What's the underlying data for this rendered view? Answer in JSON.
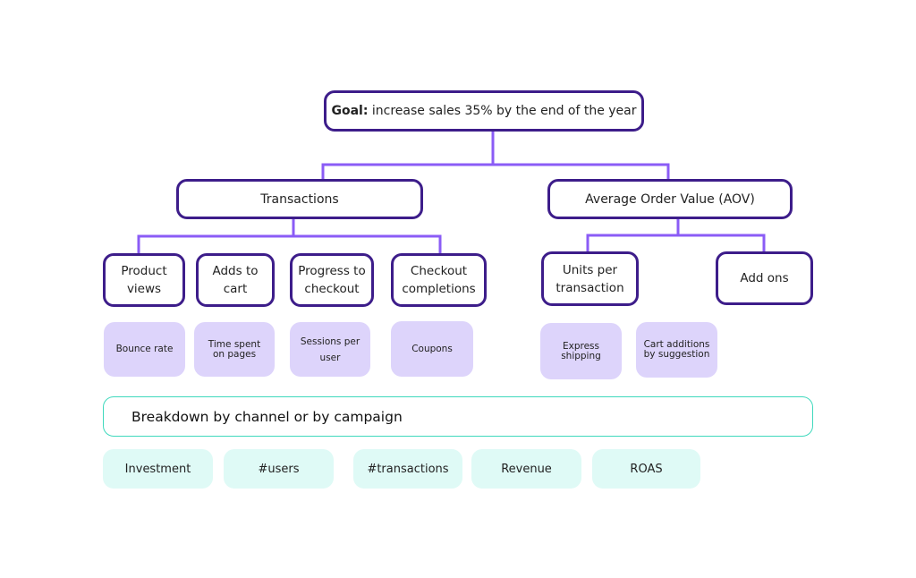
{
  "goal": {
    "label_bold": "Goal:",
    "label_rest": " increase sales 35% by the end of the year"
  },
  "level1": [
    {
      "label": "Transactions"
    },
    {
      "label": "Average Order Value (AOV)"
    }
  ],
  "transactions_children": [
    {
      "line1": "Product",
      "line2": "views"
    },
    {
      "line1": "Adds to",
      "line2": "cart"
    },
    {
      "line1": "Progress to",
      "line2": "checkout"
    },
    {
      "line1": "Checkout",
      "line2": "completions"
    }
  ],
  "aov_children": [
    {
      "line1": "Units per",
      "line2": "transaction"
    },
    {
      "line1": "Add ons",
      "line2": ""
    }
  ],
  "metric_tags": [
    {
      "line1": "Bounce rate",
      "line2": ""
    },
    {
      "line1": "Time spent",
      "line2": "on pages"
    },
    {
      "line1": "Sessions per",
      "line2": "user"
    },
    {
      "line1": "Coupons",
      "line2": ""
    },
    {
      "line1": "Express",
      "line2": "shipping"
    },
    {
      "line1": "Cart additions",
      "line2": "by suggestion"
    }
  ],
  "breakdown": {
    "label": "Breakdown by channel or by campaign"
  },
  "breakdown_metrics": [
    {
      "label": "Investment"
    },
    {
      "label": "#users"
    },
    {
      "label": "#transactions"
    },
    {
      "label": "Revenue"
    },
    {
      "label": "ROAS"
    }
  ],
  "colors": {
    "node_border": "#3d1d8a",
    "connector": "#8b5cf6",
    "metric_tag_bg": "#ddd4fb",
    "breakdown_border": "#3fd9bd",
    "breakdown_chip_bg": "#dffaf6"
  }
}
